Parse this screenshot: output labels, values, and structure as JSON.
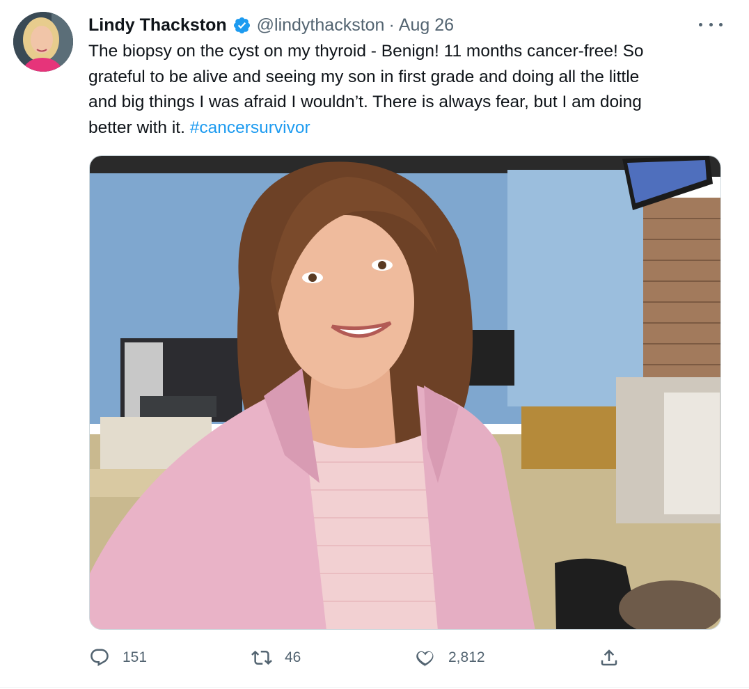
{
  "tweet": {
    "author": {
      "name": "Lindy Thackston",
      "handle": "@lindythackston",
      "verified": true,
      "avatar_icon": "profile-photo"
    },
    "separator": "·",
    "date": "Aug 26",
    "text_lines": [
      "The biopsy on the cyst on my thyroid - Benign! 11 months cancer-free! So",
      "grateful to be alive and seeing my son in first grade and doing all the little",
      "and big things I was afraid I wouldn’t. There is always fear, but I am doing",
      "better with it. "
    ],
    "hashtag": "#cancersurvivor",
    "media_alt": "Selfie of a smiling woman with wavy auburn hair wearing a pink blazer in a newsroom",
    "actions": {
      "reply_count": "151",
      "retweet_count": "46",
      "like_count": "2,812"
    }
  },
  "colors": {
    "text_primary": "#0f1419",
    "text_secondary": "#536471",
    "link": "#1d9bf0",
    "verified_badge": "#1d9bf0"
  }
}
